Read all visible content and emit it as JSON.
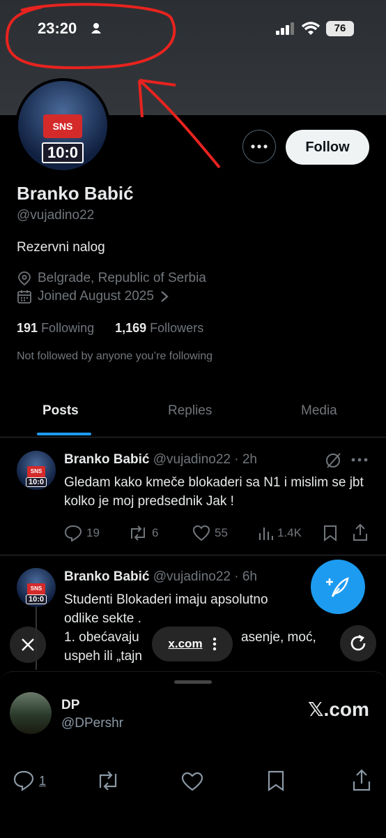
{
  "status_bar": {
    "time": "23:20",
    "battery": "76"
  },
  "profile": {
    "display_name": "Branko Babić",
    "handle": "@vujadino22",
    "bio": "Rezervni nalog",
    "location": "Belgrade, Republic of Serbia",
    "joined": "Joined August 2025",
    "following_count": "191",
    "following_label": "Following",
    "followers_count": "1,169",
    "followers_label": "Followers",
    "not_followed_text": "Not followed by anyone you’re following",
    "follow_label": "Follow",
    "avatar_score": "10:0",
    "avatar_shirt": "SNS"
  },
  "tabs": [
    "Posts",
    "Replies",
    "Media"
  ],
  "posts": [
    {
      "name": "Branko Babić",
      "handle_time": "@vujadino22 · 2h",
      "text": "Gledam kako kmeče blokaderi sa N1 i mislim se jbt kolko je moj predsednik Jak !",
      "replies": "19",
      "reposts": "6",
      "likes": "55",
      "views": "1.4K"
    },
    {
      "name": "Branko Babić",
      "handle_time": "@vujadino22 · 6h",
      "line1": "Studenti Blokaderi  imaju apsolutno",
      "line2": "odlike sekte .",
      "line3": "1. obećavaju",
      "line3b": "asenje, moć,",
      "line4": "uspeh ili „tajn"
    }
  ],
  "browser": {
    "url": "x.com"
  },
  "sheet": {
    "name": "DP",
    "handle": "@DPershr",
    "brand": "𝕏.com",
    "reply_count": "1"
  },
  "colors": {
    "accent": "#1d9bf0",
    "annotation": "#e8231f"
  }
}
